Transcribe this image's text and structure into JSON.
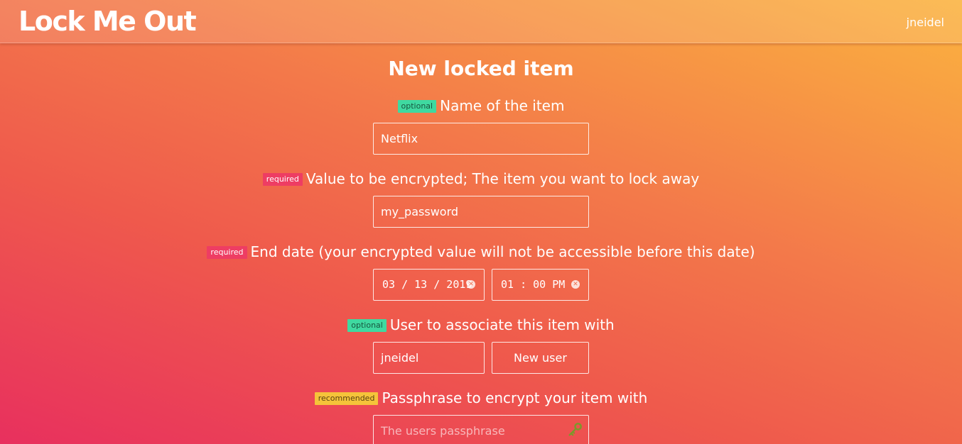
{
  "header": {
    "brand": "Lock Me Out",
    "username": "jneidel"
  },
  "page_title": "New locked item",
  "fields": {
    "name": {
      "tag": "optional",
      "label": "Name of the item",
      "value": "Netflix"
    },
    "value": {
      "tag": "required",
      "label": "Value to be encrypted; The item you want to lock away",
      "value": "my_password"
    },
    "end_date": {
      "tag": "required",
      "label": "End date (your encrypted value will not be accessible before this date)",
      "date_value": "03 / 13 / 2019",
      "time_value": "01 : 00  PM"
    },
    "user": {
      "tag": "optional",
      "label": "User to associate this item with",
      "value": "jneidel",
      "new_user_button": "New user"
    },
    "passphrase": {
      "tag": "recommended",
      "label": "Passphrase to encrypt your item with",
      "placeholder": "The users passphrase",
      "icon": "key-icon"
    }
  },
  "colors": {
    "optional_tag": "#3fd9a0",
    "required_tag": "#ee3d63",
    "recommended_tag": "#f5c33a",
    "gradient_start": "#e8305e",
    "gradient_end": "#fbb33f"
  }
}
